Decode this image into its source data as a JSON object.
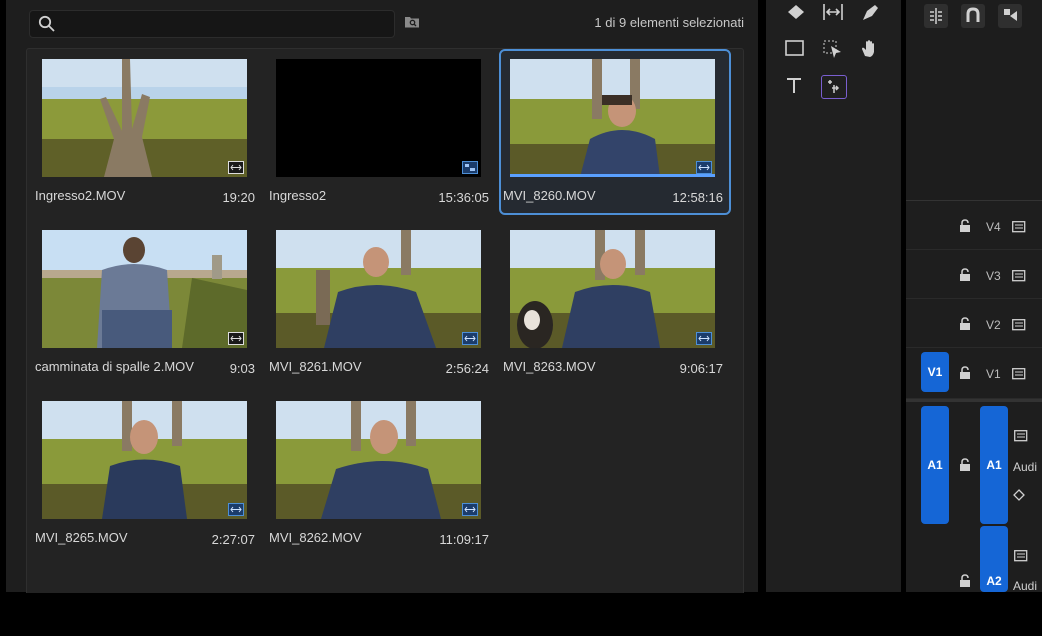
{
  "project": {
    "search_placeholder": "",
    "selection_status": "1 di 9 elementi selezionati",
    "clips": [
      {
        "name": "Ingresso2.MOV",
        "duration": "19:20",
        "kind": "video",
        "scene": "tree"
      },
      {
        "name": "Ingresso2",
        "duration": "15:36:05",
        "kind": "sequence",
        "scene": "black"
      },
      {
        "name": "MVI_8260.MOV",
        "duration": "12:58:16",
        "kind": "video",
        "scene": "man-tree-hand",
        "selected": true
      },
      {
        "name": "camminata di spalle 2.MOV",
        "duration": "9:03",
        "kind": "video",
        "scene": "walk"
      },
      {
        "name": "MVI_8261.MOV",
        "duration": "2:56:24",
        "kind": "video",
        "scene": "man-sitting"
      },
      {
        "name": "MVI_8263.MOV",
        "duration": "9:06:17",
        "kind": "video",
        "scene": "man-dog"
      },
      {
        "name": "MVI_8265.MOV",
        "duration": "2:27:07",
        "kind": "video",
        "scene": "man-close"
      },
      {
        "name": "MVI_8262.MOV",
        "duration": "11:09:17",
        "kind": "video",
        "scene": "man-sitting2"
      }
    ]
  },
  "timeline": {
    "video_tracks": [
      "V4",
      "V3",
      "V2",
      "V1"
    ],
    "source_video_patch": "V1",
    "audio_tracks": [
      {
        "source": "A1",
        "target": "A1",
        "label": "Audi"
      },
      {
        "source": "",
        "target": "A2",
        "label": "Audi"
      }
    ]
  },
  "colors": {
    "accent": "#1566d6",
    "selection_outline": "#4d8fd6",
    "panel_bg": "#1e1e1e"
  }
}
